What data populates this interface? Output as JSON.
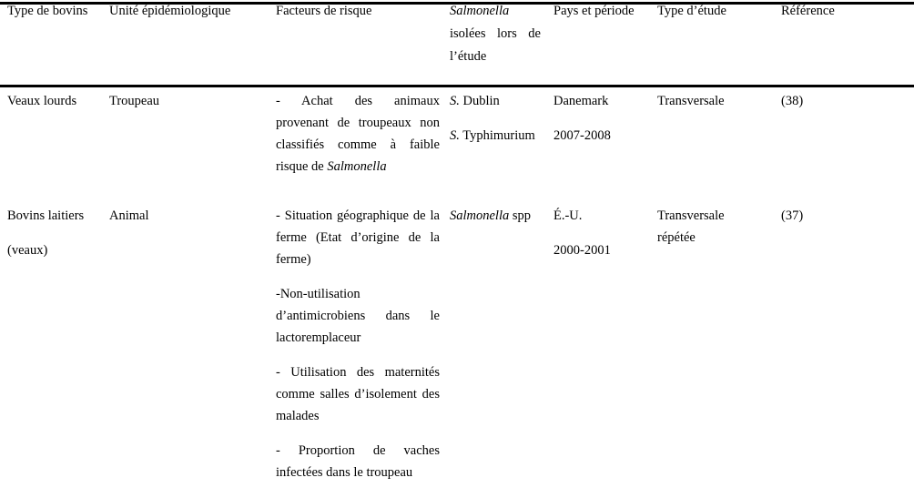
{
  "document": {
    "type": "scientific-table",
    "language": "fr"
  },
  "table": {
    "headers": [
      {
        "id": "type-de-bovins",
        "label": "Type de bovins"
      },
      {
        "id": "unite-epidemiologique",
        "label": "Unité épidémiologique"
      },
      {
        "id": "facteurs-de-risque",
        "label": "Facteurs de risque"
      },
      {
        "id": "salmonella-isolees",
        "label_italic": "Salmonella",
        "label_line2": "isolées lors de",
        "label_line3": "l’étude"
      },
      {
        "id": "pays-et-periode",
        "label": "Pays et période"
      },
      {
        "id": "type-d-etude",
        "label": "Type d’étude"
      },
      {
        "id": "reference",
        "label": "Référence"
      }
    ],
    "rows": [
      {
        "type_de_bovins": "Veaux lourds",
        "type_de_bovins_line2": "",
        "unite_epidemiologique": "Troupeau",
        "facteurs_de_risque": [
          "- Achat des animaux provenant de troupeaux non classifiés comme à faible risque de Salmonella"
        ],
        "facteurs_de_risque_parts": [
          {
            "text": "- Achat des animaux provenant de troupeaux non classifiés comme à faible risque de ",
            "italic_tail": "Salmonella"
          }
        ],
        "salmonella": [
          {
            "genus": "S.",
            "species": "Dublin"
          },
          {
            "genus": "S.",
            "species": "Typhimurium"
          }
        ],
        "pays_et_periode": [
          "Danemark",
          "2007-2008"
        ],
        "type_d_etude": [
          "Transversale"
        ],
        "reference": "(38)"
      },
      {
        "type_de_bovins": "Bovins laitiers",
        "type_de_bovins_line2": "(veaux)",
        "unite_epidemiologique": "Animal",
        "facteurs_de_risque_parts": [
          {
            "text": "- Situation géographique de la ferme (Etat d’origine de la ferme)",
            "italic_tail": ""
          },
          {
            "text": "-Non-utilisation d’antimicrobiens dans le lactoremplaceur",
            "italic_tail": ""
          },
          {
            "text": "- Utilisation des maternités comme salles d’isolement des malades",
            "italic_tail": ""
          },
          {
            "text": "- Proportion de vaches infectées dans le troupeau",
            "italic_tail": ""
          }
        ],
        "salmonella": [
          {
            "genus": "Salmonella",
            "species": "spp"
          }
        ],
        "pays_et_periode": [
          "É.-U.",
          "2000-2001"
        ],
        "type_d_etude": [
          "Transversale",
          "répétée"
        ],
        "reference": "(37)"
      }
    ]
  },
  "style": {
    "text_color": "#000000",
    "background": "#ffffff",
    "rule_color": "#000000"
  }
}
